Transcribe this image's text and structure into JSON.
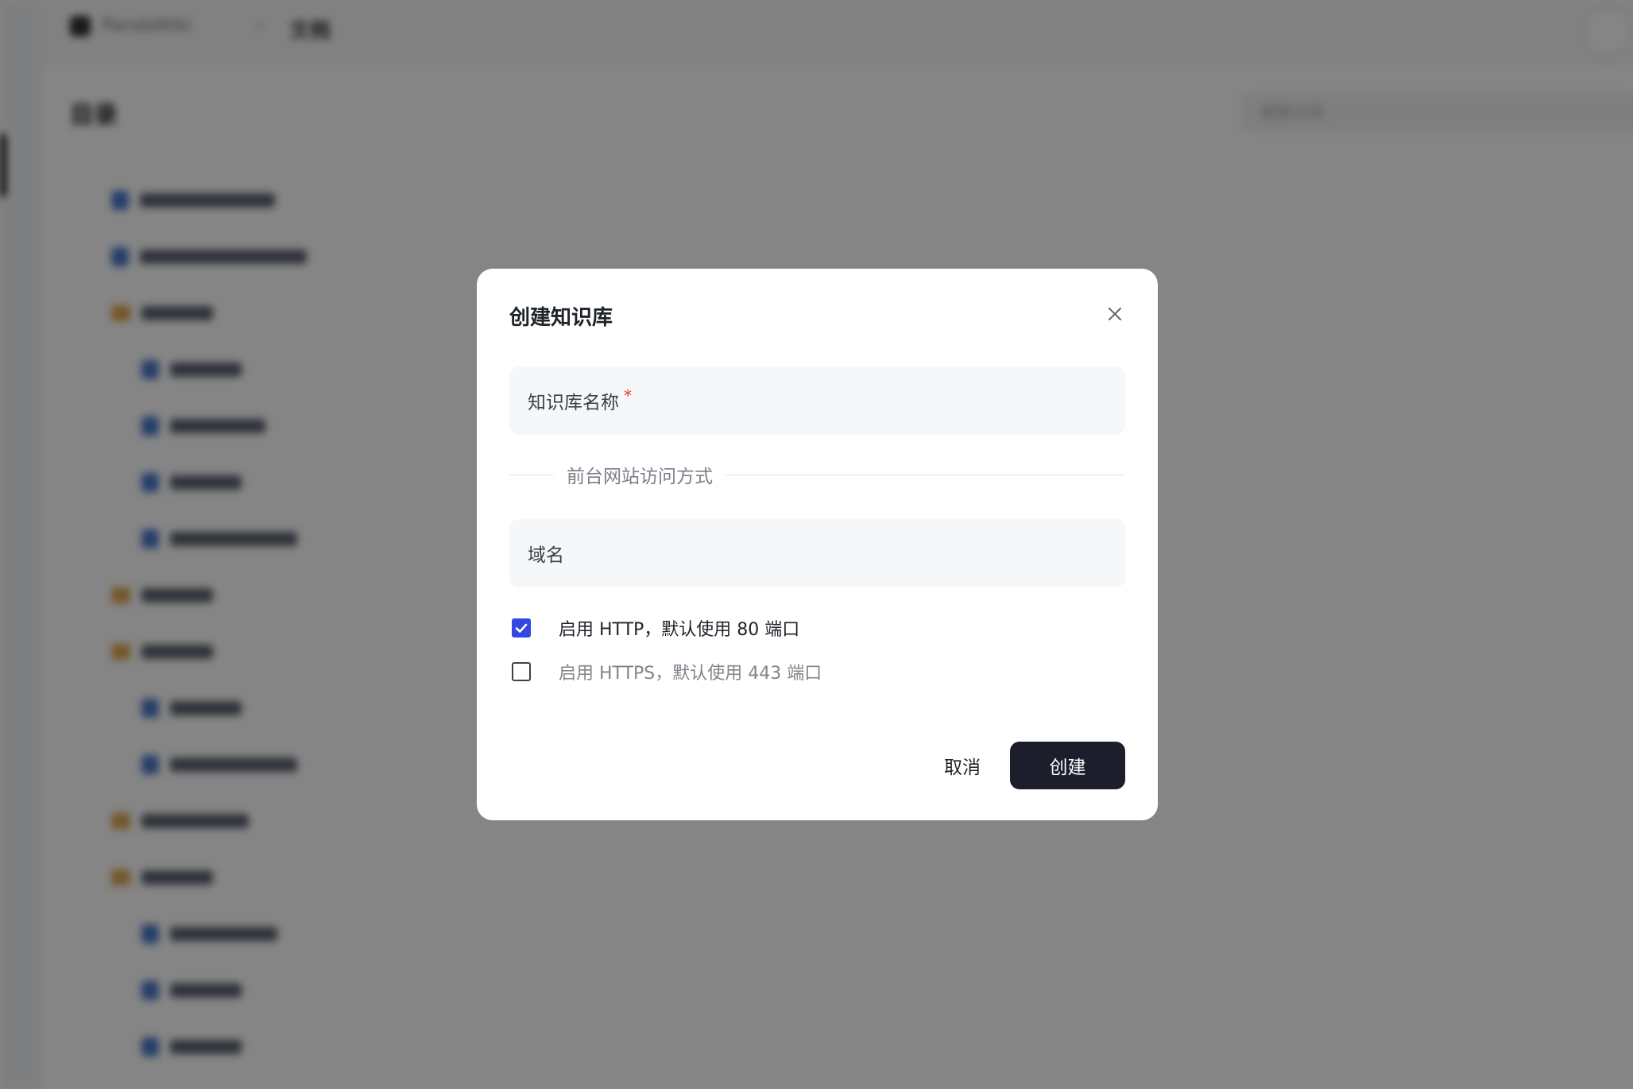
{
  "background": {
    "app_name": "PandaWiki",
    "breadcrumb": "文档",
    "page_title": "目录",
    "search_placeholder": "搜索文档"
  },
  "dialog": {
    "title": "创建知识库",
    "close_icon": "close-icon",
    "name_field": {
      "label": "知识库名称",
      "required_mark": "*"
    },
    "divider_label": "前台网站访问方式",
    "domain_field": {
      "label": "域名"
    },
    "options": [
      {
        "label": "启用 HTTP，默认使用 80 端口",
        "checked": true
      },
      {
        "label": "启用 HTTPS，默认使用 443 端口",
        "checked": false
      }
    ],
    "cancel_label": "取消",
    "create_label": "创建"
  },
  "colors": {
    "overlay": "rgba(0,0,0,0.48)",
    "checkbox_accent": "#3248e0",
    "primary_button": "#1d1e2c",
    "required": "#e33b3b"
  }
}
